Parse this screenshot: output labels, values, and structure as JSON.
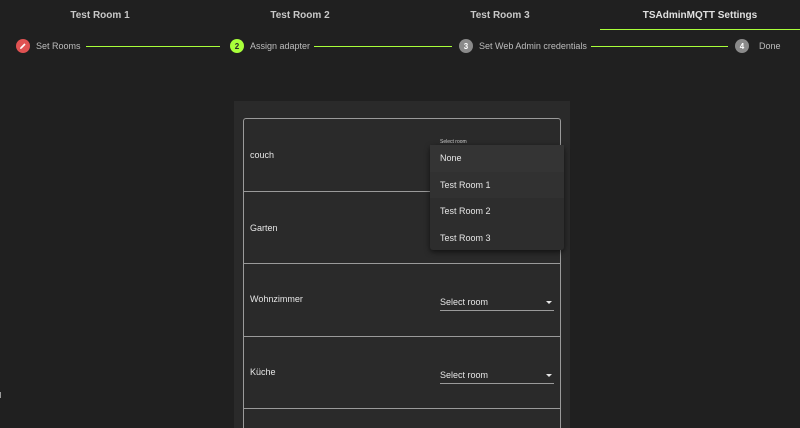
{
  "tabs": [
    {
      "label": "Test Room 1",
      "active": false
    },
    {
      "label": "Test Room 2",
      "active": false
    },
    {
      "label": "Test Room 3",
      "active": false
    },
    {
      "label": "TSAdminMQTT Settings",
      "active": true
    }
  ],
  "stepper": {
    "steps": [
      {
        "label": "Set Rooms",
        "state": "edit",
        "bullet": "pencil-icon"
      },
      {
        "label": "Assign adapter",
        "state": "active",
        "bullet": "2"
      },
      {
        "label": "Set Web Admin credentials",
        "state": "pending",
        "bullet": "3"
      },
      {
        "label": "Done",
        "state": "pending",
        "bullet": "4"
      }
    ]
  },
  "adapters": [
    {
      "name": "couch",
      "select_label": "Select room",
      "select_open": true
    },
    {
      "name": "Garten",
      "select_label": "",
      "select_open": false
    },
    {
      "name": "Wohnzimmer",
      "select_label": "Select room",
      "select_open": false
    },
    {
      "name": "Küche",
      "select_label": "Select room",
      "select_open": false
    },
    {
      "name": "",
      "select_label": "",
      "select_open": false
    }
  ],
  "dropdown": {
    "options": [
      {
        "label": "None",
        "selected": true
      },
      {
        "label": "Test Room 1",
        "selected": false
      },
      {
        "label": "Test Room 2",
        "selected": false
      },
      {
        "label": "Test Room 3",
        "selected": false
      }
    ]
  },
  "colors": {
    "accent": "#a8ff3a",
    "edit_step": "#e05252",
    "pending_step": "#8a8a8a",
    "background": "#202020",
    "card": "#2a2a2a"
  }
}
